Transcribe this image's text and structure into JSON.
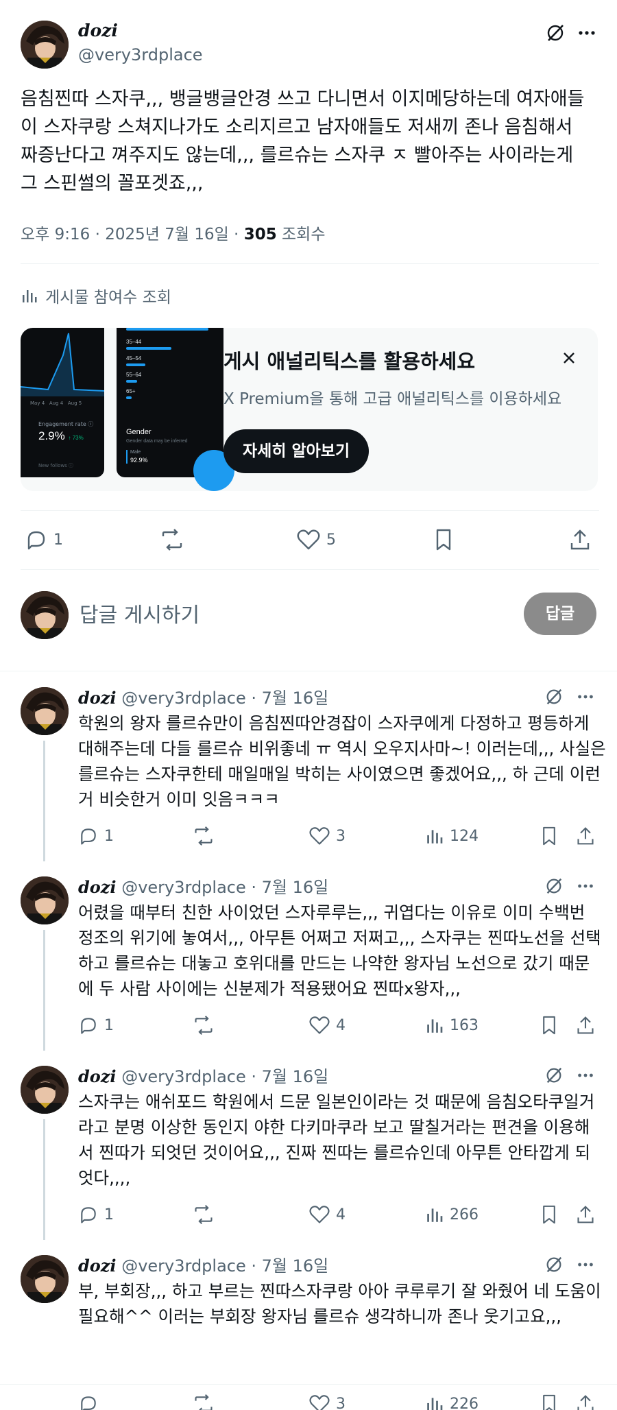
{
  "main_post": {
    "display_name": "dozi",
    "handle": "@very3rdplace",
    "text": "음침찐따 스자쿠,,, 뱅글뱅글안경 쓰고 다니면서 이지메당하는데 여자애들\n이 스자쿠랑 스쳐지나가도 소리지르고 남자애들도 저새끼 존나 음침해서\n짜증난다고 껴주지도 않는데,,, 를르슈는 스자쿠 ㅈ 빨아주는 사이라는게\n그 스핀썰의 꼴포겟죠,,,",
    "time": "오후 9:16 · 2025년 7월 16일 · ",
    "views_count": "305",
    "views_label": " 조회수",
    "engagement_link": "게시물 참여수 조회",
    "stats": {
      "replies": "1",
      "likes": "5"
    }
  },
  "promo": {
    "title": "게시 애널리틱스를 활용하세요",
    "subtitle": "X Premium을 통해 고급 애널리틱스를 이용하세요",
    "button": "자세히 알아보기",
    "thumb_left": {
      "engagement_label": "Engagement rate ⓘ",
      "value": "2.9%",
      "delta": "↑ 73%",
      "dates": "May 4   Aug 4   Aug 5",
      "footer": "New follows ⓘ"
    },
    "thumb_right": {
      "ages": [
        "35–44",
        "45–54",
        "55–64",
        "65+"
      ],
      "gender_title": "Gender",
      "gender_sub": "Gender data may be inferred",
      "male_label": "Male",
      "male_value": "92.9%"
    }
  },
  "compose": {
    "placeholder": "답글 게시하기",
    "button": "답글"
  },
  "replies": [
    {
      "display_name": "dozi",
      "handle_date": "@very3rdplace · 7월 16일",
      "text": "학원의 왕자 를르슈만이 음침찐따안경잡이 스자쿠에게 다정하고 평등하게\n대해주는데 다들 를르슈 비위좋네 ㅠ 역시 오우지사마~! 이러는데,,, 사실은\n를르슈는 스자쿠한테 매일매일 박히는 사이였으면 좋겠어요,,, 하 근데 이런\n거 비슷한거 이미 잇음ㅋㅋㅋ",
      "replies": "1",
      "retweets": "",
      "likes": "3",
      "views": "124"
    },
    {
      "display_name": "dozi",
      "handle_date": "@very3rdplace · 7월 16일",
      "text": "어렸을 때부터 친한 사이었던 스자루루는,,, 귀엽다는 이유로 이미 수백번\n정조의 위기에 놓여서,,, 아무튼 어쩌고 저쩌고,,, 스자쿠는 찐따노선을 선택\n하고 를르슈는 대놓고 호위대를 만드는 나약한 왕자님 노선으로 갔기 때문\n에 두 사람 사이에는 신분제가 적용됐어요 찐따x왕자,,,",
      "replies": "1",
      "retweets": "",
      "likes": "4",
      "views": "163"
    },
    {
      "display_name": "dozi",
      "handle_date": "@very3rdplace · 7월 16일",
      "text": "스자쿠는 애쉬포드 학원에서 드문 일본인이라는 것 때문에 음침오타쿠일거\n라고 분명 이상한 동인지 야한 다키마쿠라 보고 딸칠거라는 편견을 이용해\n서 찐따가 되엇던 것이어요,,, 진짜 찐따는 를르슈인데 아무튼 안타깝게 되\n엇다,,,,",
      "replies": "1",
      "retweets": "",
      "likes": "4",
      "views": "266"
    },
    {
      "display_name": "dozi",
      "handle_date": "@very3rdplace · 7월 16일",
      "text": "부, 부회장,,, 하고 부르는 찐따스자쿠랑 아아 쿠루루기 잘 와줬어 네 도움이\n필요해^^ 이러는 부회장 왕자님 를르슈 생각하니까 존나 웃기고요,,,",
      "replies": "",
      "retweets": "",
      "likes": "3",
      "views": "226"
    }
  ]
}
